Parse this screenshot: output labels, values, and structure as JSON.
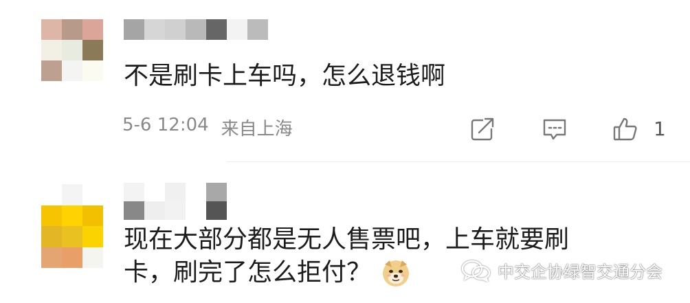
{
  "comments": [
    {
      "text": "不是刷卡上车吗，怎么退钱啊",
      "time": "5-6 12:04",
      "location": "来自上海",
      "like_count": "1",
      "avatar_colors": [
        "#deb6a8",
        "#b89a8a",
        "#dba59a",
        "#f2f0e4",
        "#e8ebe0",
        "#8a7a58",
        "#bea090",
        "#f4f4f2",
        "#fbfbf2"
      ],
      "username_colors": [
        "#a5a5a5",
        "#d6d6d6",
        "#d0d0d0",
        "#b9b9b9",
        "#666666",
        "#f3f3f3",
        "#bbbbbb"
      ]
    },
    {
      "text_line1": "现在大部分都是无人售票吧，上车就要刷",
      "text_line2": "卡，刷完了怎么拒付？",
      "emoji": "doge-emoji",
      "avatar_colors": [
        "#ffffff",
        "#f4f4f4",
        "#ffffff",
        "#f6c400",
        "#ffd200",
        "#f2c000",
        "#e2b624",
        "#e9c120",
        "#fbd300",
        "#e4a572",
        "#e8a068",
        "#f5f5f0"
      ],
      "username_colors": [
        "#f3f3f3",
        "#ffffff",
        "#f0f0f0",
        "#ffffff",
        "#a8a8a8",
        "#888888",
        "#eeeeee",
        "#f2f2f2",
        "#ffffff",
        "#555555"
      ]
    }
  ],
  "icons": {
    "share": "share-icon",
    "reply": "comment-icon",
    "like": "thumbs-up-icon"
  },
  "watermark": {
    "text": "中交企协绿智交通分会",
    "icon": "wechat-icon"
  }
}
